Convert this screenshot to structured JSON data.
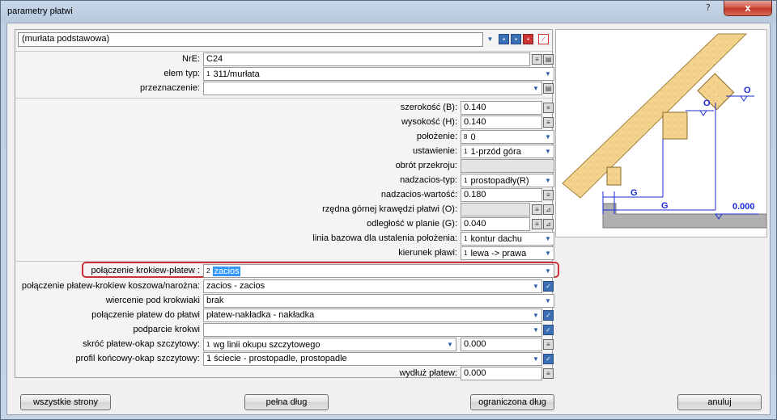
{
  "window": {
    "title": "parametry płatwi",
    "help": "?",
    "close": "x"
  },
  "header": {
    "name_value": "(murłata podstawowa)"
  },
  "fields": {
    "nre": {
      "label": "NrE:",
      "value": "C24"
    },
    "elem_typ": {
      "label": "elem typ:",
      "num": "1",
      "value": "311/murłata"
    },
    "przeznaczenie": {
      "label": "przeznaczenie:",
      "value": ""
    },
    "szerokosc": {
      "label": "szerokość (B):",
      "value": "0.140"
    },
    "wysokosc": {
      "label": "wysokość (H):",
      "value": "0.140"
    },
    "polozenie": {
      "label": "położenie:",
      "num": "8",
      "value": "0"
    },
    "ustawienie": {
      "label": "ustawienie:",
      "num": "1",
      "value": "1-przód góra"
    },
    "obrot": {
      "label": "obrót przekroju:",
      "value": ""
    },
    "nadzacios_typ": {
      "label": "nadzacios-typ:",
      "num": "1",
      "value": "prostopadły(R)"
    },
    "nadzacios_wartosc": {
      "label": "nadzacios-wartość:",
      "value": "0.180"
    },
    "rzedna": {
      "label": "rzędna górnej krawędzi płatwi (O):",
      "value": ""
    },
    "odleglosc": {
      "label": "odległość w planie (G):",
      "value": "0.040"
    },
    "linia_bazowa": {
      "label": "linia bazowa dla ustalenia położenia:",
      "num": "1",
      "value": "kontur dachu"
    },
    "kierunek": {
      "label": "kierunek pławi:",
      "num": "1",
      "value": "lewa -> prawa"
    },
    "polaczenie_krokiew": {
      "label": "połączenie krokiew-płatew :",
      "num": "2",
      "value": "zacios"
    },
    "polaczenie_koszowa": {
      "label": "połączenie płatew-krokiew koszowa/narożna:",
      "value": "zacios - zacios"
    },
    "wiercenie": {
      "label": "wiercenie pod krokwiaki",
      "value": "brak"
    },
    "polaczenie_platew": {
      "label": "połączenie płatew do płatwi",
      "value": "płatew-nakładka - nakładka"
    },
    "podparcie": {
      "label": "podparcie krokwi",
      "value": ""
    },
    "skroc": {
      "label": "skróć płatew-okap szczytowy:",
      "num": "1",
      "value": "wg linii okupu szczytowego",
      "value2": "0.000"
    },
    "profil": {
      "label": "profil końcowy-okap szczytowy:",
      "value": "1 ściecie - prostopadle, prostopadle"
    },
    "wydluz": {
      "label": "wydłuż płatew:",
      "value": "0.000"
    }
  },
  "buttons": {
    "all_pages": "wszystkie strony",
    "full_length": "pełna dług",
    "limited_length": "ograniczona dług",
    "cancel": "anuluj"
  },
  "drawing": {
    "label_o1": "O",
    "label_o2": "O",
    "label_g1": "G",
    "label_g2": "G",
    "label_level": "0.000"
  },
  "colors": {
    "highlight": "#c9313a",
    "selection": "#3399ff",
    "dimension": "#1a2bd6",
    "wood": "#f2d28c"
  }
}
